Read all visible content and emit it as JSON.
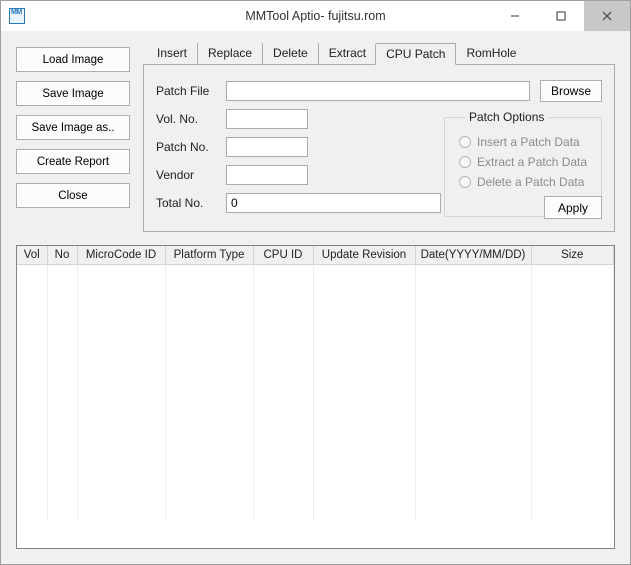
{
  "titlebar": {
    "title": "MMTool Aptio- fujitsu.rom"
  },
  "sidebar_buttons": {
    "load_image": "Load Image",
    "save_image": "Save Image",
    "save_image_as": "Save Image as..",
    "create_report": "Create Report",
    "close": "Close"
  },
  "tabs": {
    "insert": "Insert",
    "replace": "Replace",
    "delete": "Delete",
    "extract": "Extract",
    "cpu_patch": "CPU Patch",
    "romhole": "RomHole"
  },
  "cpu_patch_page": {
    "patch_file_label": "Patch File",
    "patch_file_value": "",
    "browse_label": "Browse",
    "vol_no_label": "Vol. No.",
    "vol_no_value": "",
    "patch_no_label": "Patch No.",
    "patch_no_value": "",
    "vendor_label": "Vendor",
    "vendor_value": "",
    "total_no_label": "Total No.",
    "total_no_value": "0",
    "options_group_title": "Patch Options",
    "opt_insert": "Insert a Patch Data",
    "opt_extract": "Extract a Patch Data",
    "opt_delete": "Delete a Patch Data",
    "apply_label": "Apply"
  },
  "table": {
    "columns": {
      "vol": "Vol",
      "no": "No",
      "microcode_id": "MicroCode ID",
      "platform_type": "Platform Type",
      "cpu_id": "CPU ID",
      "update_revision": "Update Revision",
      "date": "Date(YYYY/MM/DD)",
      "size": "Size"
    }
  }
}
